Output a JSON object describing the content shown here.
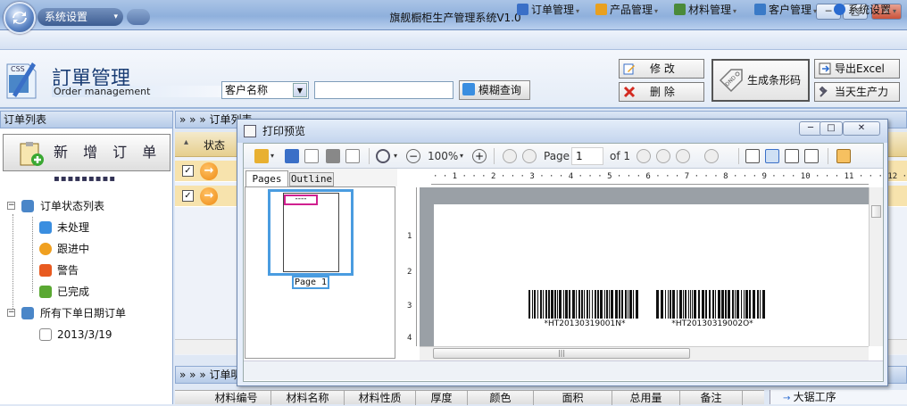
{
  "window": {
    "title": "旗舰橱柜生产管理系统V1.0",
    "min": "─",
    "max": "□",
    "close": "✕"
  },
  "system_menu": {
    "label": "系统设置",
    "chevron": "▾"
  },
  "menu": [
    {
      "label": "订单管理",
      "icon": "order-icon",
      "color": "#3a6fc7"
    },
    {
      "label": "产品管理",
      "icon": "product-icon",
      "color": "#e8a020"
    },
    {
      "label": "材料管理",
      "icon": "material-icon",
      "color": "#4a8a3a"
    },
    {
      "label": "客户管理",
      "icon": "customer-icon",
      "color": "#3a7ac7"
    },
    {
      "label": "系统设置",
      "icon": "gear-icon",
      "color": "#2a6bd0"
    }
  ],
  "header": {
    "title": "訂單管理",
    "subtitle": "Order management",
    "css_badge": "CSS",
    "search_select": "客户名称",
    "search_value": "",
    "search_button": "模糊查询"
  },
  "actions": {
    "edit": "修  改",
    "delete": "删  除",
    "barcode": "生成条形码",
    "barcode_badge": "DND",
    "export": "导出Excel",
    "today_capacity": "当天生产力"
  },
  "left_panel": {
    "header": "订单列表",
    "new_order": "新 增 订 单",
    "dots": "▪▪▪▪▪▪▪▪▪",
    "tree": [
      {
        "label": "订单状态列表",
        "level": 0,
        "icon": "list-icon",
        "color": "#4a86c8"
      },
      {
        "label": "未处理",
        "level": 1,
        "icon": "pending-icon",
        "color": "#3a8ee0"
      },
      {
        "label": "跟进中",
        "level": 1,
        "icon": "arrow-icon",
        "color": "#f0a020"
      },
      {
        "label": "警告",
        "level": 1,
        "icon": "warning-icon",
        "color": "#e85a20"
      },
      {
        "label": "已完成",
        "level": 1,
        "icon": "done-icon",
        "color": "#5aa832"
      },
      {
        "label": "所有下单日期订单",
        "level": 0,
        "icon": "list-icon",
        "color": "#4a86c8"
      },
      {
        "label": "2013/3/19",
        "level": 1,
        "icon": "calendar-icon",
        "color": "#8a8a8a"
      }
    ]
  },
  "main": {
    "header": "» » » 订单列表",
    "status_col": "状态",
    "rows": [
      {
        "checked": true,
        "status": "→"
      },
      {
        "checked": true,
        "status": "→"
      }
    ],
    "detail_header": "» » » 订单明细",
    "detail_columns": [
      "材料编号",
      "材料名称",
      "材料性质",
      "厚度",
      "颜色",
      "面积",
      "总用量",
      "备注"
    ],
    "procedure": "大锯工序"
  },
  "dialog": {
    "title": "打印预览",
    "zoom": "100%",
    "page_label": "Page",
    "page_value": "1",
    "of_label": "of 1",
    "tab_pages": "Pages",
    "tab_outline": "Outline",
    "thumb_label": "Page 1",
    "thumb_mark": "----",
    "ruler_h": "· · 1 · · · 2 · · · 3 · · · 4 · · · 5 · · · 6 · · · 7 · · · 8 · · · 9 · · · 10 · · · 11 · · · 12 ·",
    "ruler_v": [
      "1",
      "2",
      "3",
      "4"
    ],
    "barcodes": [
      "*HT20130319001N*",
      "*HT20130319002O*"
    ]
  }
}
